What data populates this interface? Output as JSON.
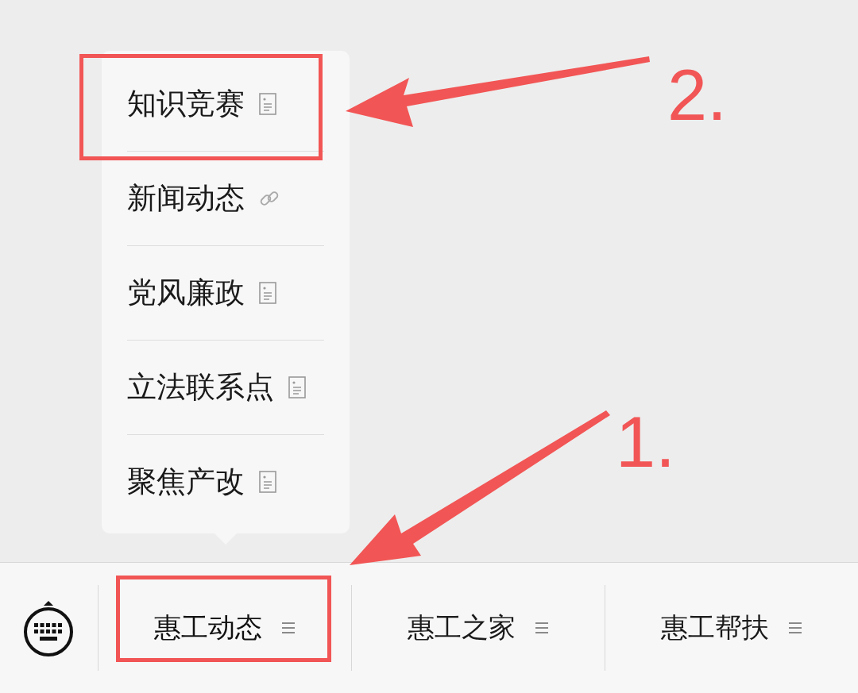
{
  "menu": {
    "items": [
      {
        "label": "知识竞赛",
        "kind": "doc"
      },
      {
        "label": "新闻动态",
        "kind": "link"
      },
      {
        "label": "党风廉政",
        "kind": "doc"
      },
      {
        "label": "立法联系点",
        "kind": "doc"
      },
      {
        "label": "聚焦产改",
        "kind": "doc"
      }
    ]
  },
  "tabs": [
    {
      "label": "惠工动态",
      "expanded": true
    },
    {
      "label": "惠工之家",
      "expanded": false
    },
    {
      "label": "惠工帮扶",
      "expanded": false
    }
  ],
  "annotations": [
    {
      "label": "2."
    },
    {
      "label": "1."
    }
  ]
}
